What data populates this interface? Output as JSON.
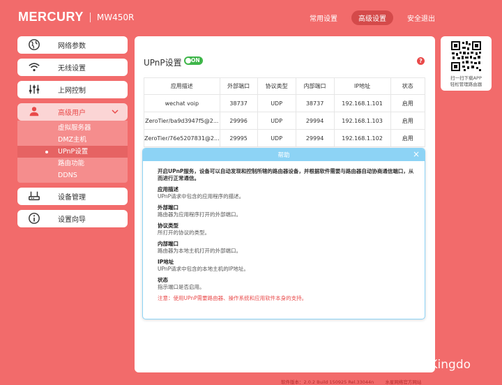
{
  "header": {
    "brand": "MERCURY",
    "model": "MW450R",
    "nav": [
      "常用设置",
      "高级设置",
      "安全退出"
    ]
  },
  "sidebar": {
    "items": [
      {
        "label": "网络参数",
        "icon": "globe-icon"
      },
      {
        "label": "无线设置",
        "icon": "wifi-icon"
      },
      {
        "label": "上网控制",
        "icon": "sliders-icon"
      },
      {
        "label": "高级用户",
        "icon": "user-icon"
      },
      {
        "label": "设备管理",
        "icon": "router-icon"
      },
      {
        "label": "设置向导",
        "icon": "info-icon"
      }
    ],
    "submenu": [
      "虚拟服务器",
      "DMZ主机",
      "UPnP设置",
      "路由功能",
      "DDNS"
    ]
  },
  "main": {
    "title": "UPnP设置",
    "toggle_label": "ON",
    "help_icon_label": "?",
    "table": {
      "headers": [
        "应用描述",
        "外部端口",
        "协议类型",
        "内部端口",
        "IP地址",
        "状态"
      ],
      "rows": [
        [
          "wechat voip",
          "38737",
          "UDP",
          "38737",
          "192.168.1.101",
          "启用"
        ],
        [
          "ZeroTier/ba9d3947f5@2...",
          "29996",
          "UDP",
          "29994",
          "192.168.1.103",
          "启用"
        ],
        [
          "ZeroTier/76e5207831@2...",
          "29995",
          "UDP",
          "29994",
          "192.168.1.102",
          "启用"
        ]
      ]
    }
  },
  "helpbox": {
    "title": "帮助",
    "close_label": "×",
    "intro": "开启UPnP服务，设备可以自动发现和控制所辖的路由器设备，并根据软件需要与路由器自动协商通信端口，从而进行正常通信。",
    "items": [
      {
        "title": "应用描述",
        "desc": "UPnP请求中包含的应用程序的描述。"
      },
      {
        "title": "外部端口",
        "desc": "路由器为应用程序打开的外部端口。"
      },
      {
        "title": "协议类型",
        "desc": "所打开的协议的类型。"
      },
      {
        "title": "内部端口",
        "desc": "路由器为本地主机打开的外部端口。"
      },
      {
        "title": "IP地址",
        "desc": "UPnP请求中包含的本地主机的IP地址。"
      },
      {
        "title": "状态",
        "desc": "指示端口是否启用。"
      }
    ],
    "note": "注意：使用UPnP需要路由器、操作系统和应用软件本身的支持。"
  },
  "qr": {
    "line1": "扫一扫下载APP",
    "line2": "轻松管理路由器"
  },
  "watermark": "知乎 @Kingdo",
  "footer": {
    "version": "软件版本：2.0.2 Build 150925 Rel.33044n",
    "site": "水星网络官方网站"
  }
}
